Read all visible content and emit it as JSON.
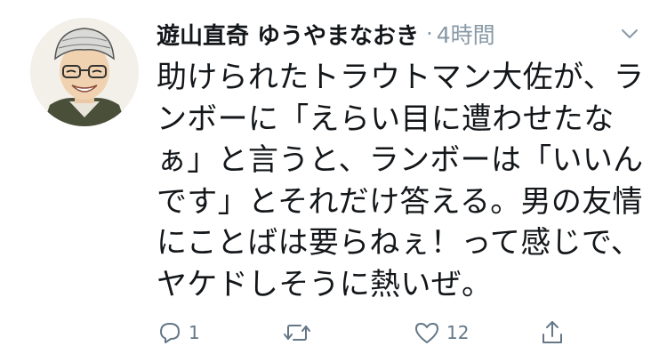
{
  "tweet": {
    "display_name": "遊山直奇 ゆうやまなおき",
    "separator": "·",
    "timestamp": "4時間",
    "text_lines": [
      "助けられたトラウトマン大佐が、ラ",
      "ンボーに「えらい目に遭わせたな",
      "ぁ」と言うと、ランボーは「いいん",
      "です」とそれだけ答える。男の友情",
      "にことばは要らねぇ！って感じで、",
      "ヤケドしそうに熱いぜ。"
    ],
    "actions": {
      "reply_count": "1",
      "retweet_count": "",
      "like_count": "12"
    }
  },
  "icons": {
    "avatar": "avatar",
    "menu": "chevron-down-icon",
    "reply": "reply-icon",
    "retweet": "retweet-icon",
    "like": "heart-icon",
    "share": "share-icon"
  },
  "colors": {
    "text": "#14171a",
    "secondary": "#8899a6",
    "icon": "#657786"
  }
}
